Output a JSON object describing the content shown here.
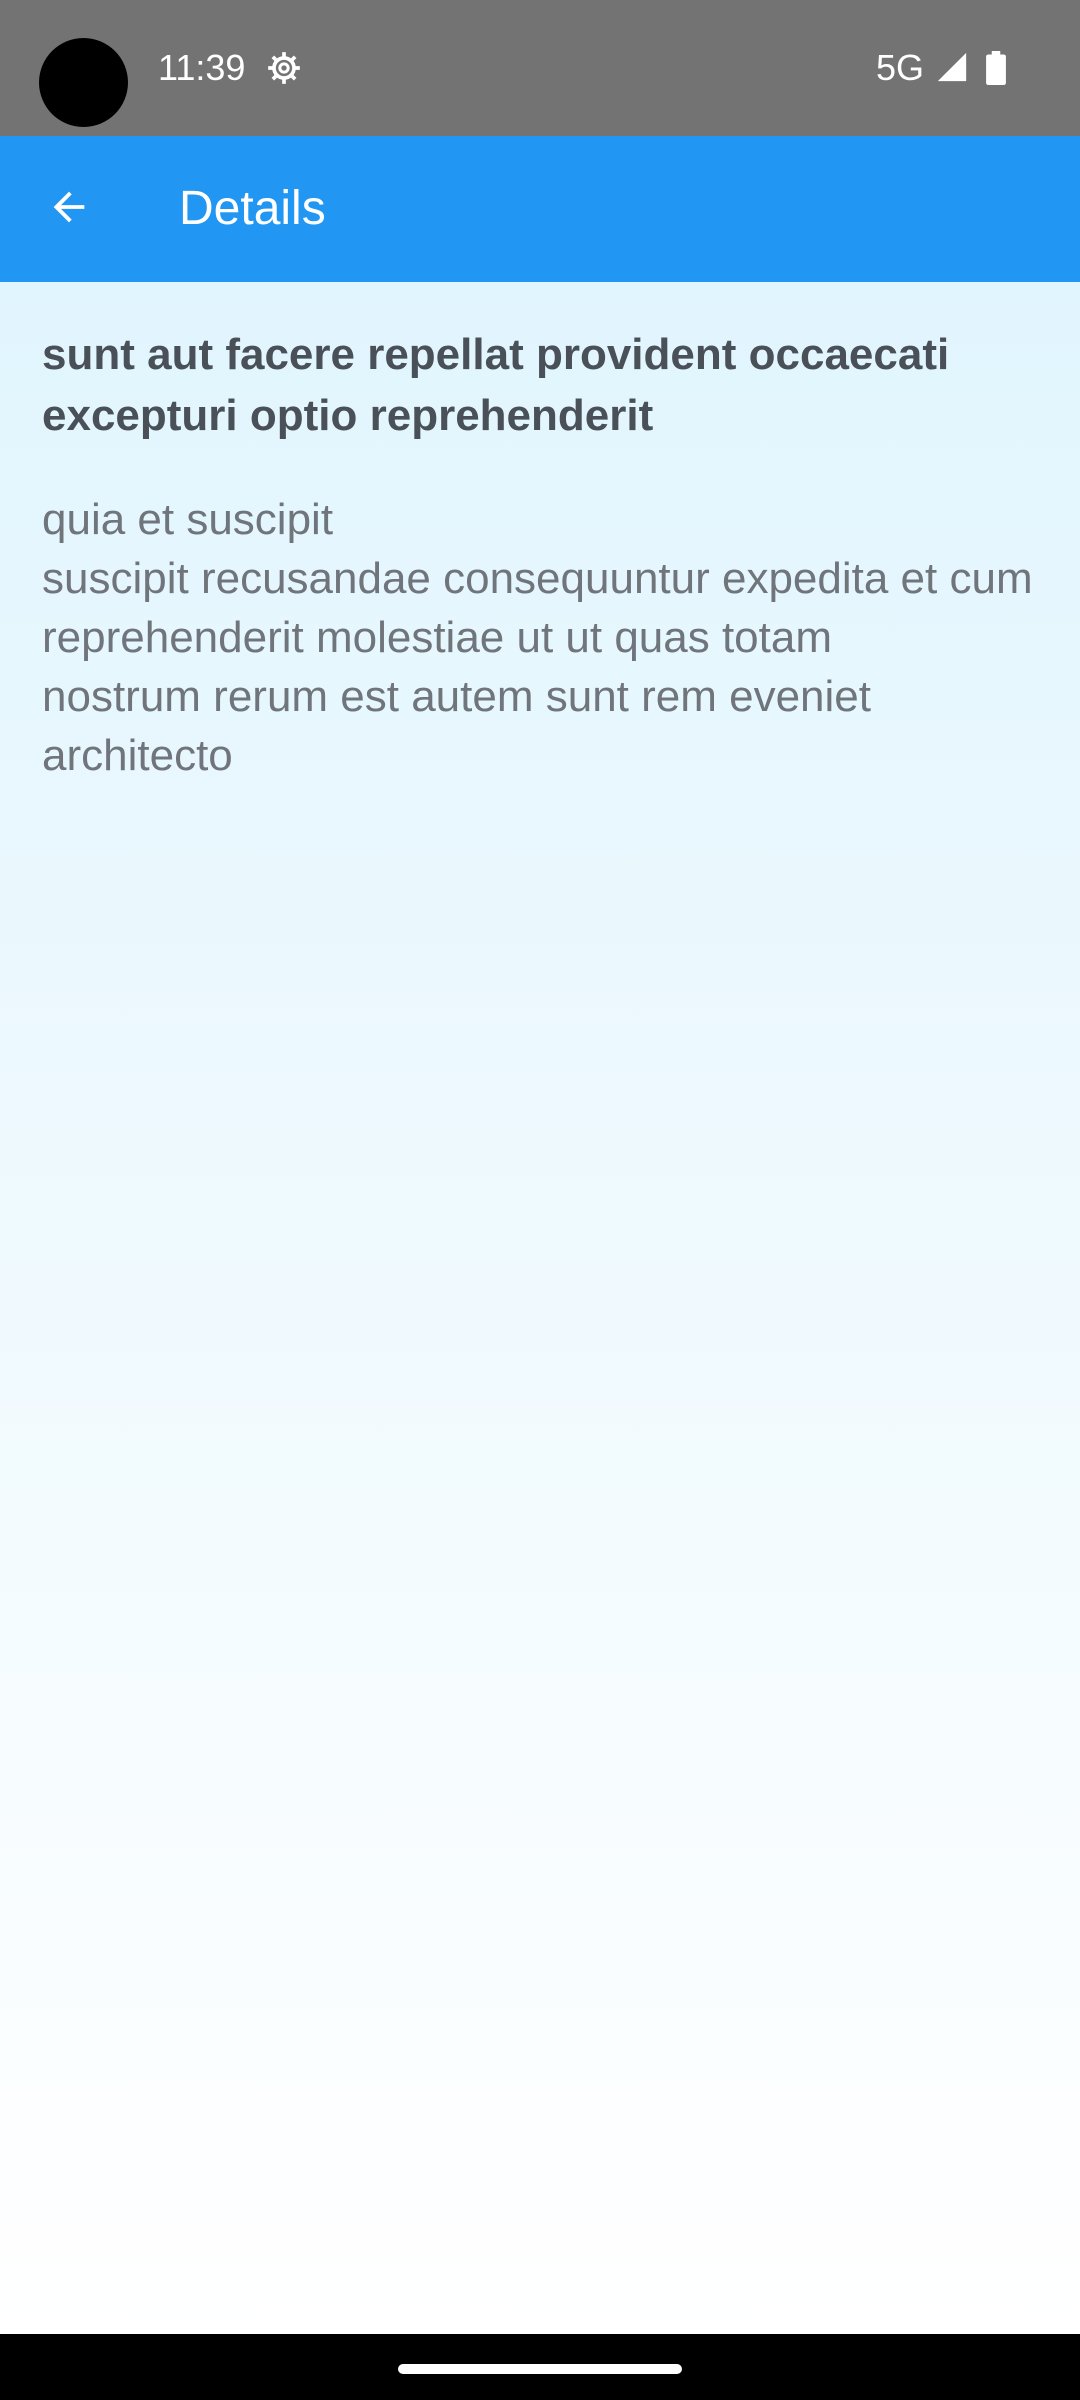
{
  "status_bar": {
    "time": "11:39",
    "network": "5G",
    "icons": [
      "settings-gear-icon",
      "signal-icon",
      "battery-icon"
    ]
  },
  "app_bar": {
    "title": "Details",
    "back_icon": "arrow-back-icon",
    "color": "#2196f3"
  },
  "post": {
    "title": "sunt aut facere repellat provident occaecati excepturi optio reprehenderit",
    "body": "quia et suscipit\nsuscipit recusandae consequuntur expedita et cum\nreprehenderit molestiae ut ut quas totam\nnostrum rerum est autem sunt rem eveniet architecto"
  },
  "colors": {
    "status_bar": "#737373",
    "background_top": "#e1f5fe",
    "background_bottom": "#ffffff",
    "title_text": "#4a5058",
    "body_text": "#70757b"
  }
}
